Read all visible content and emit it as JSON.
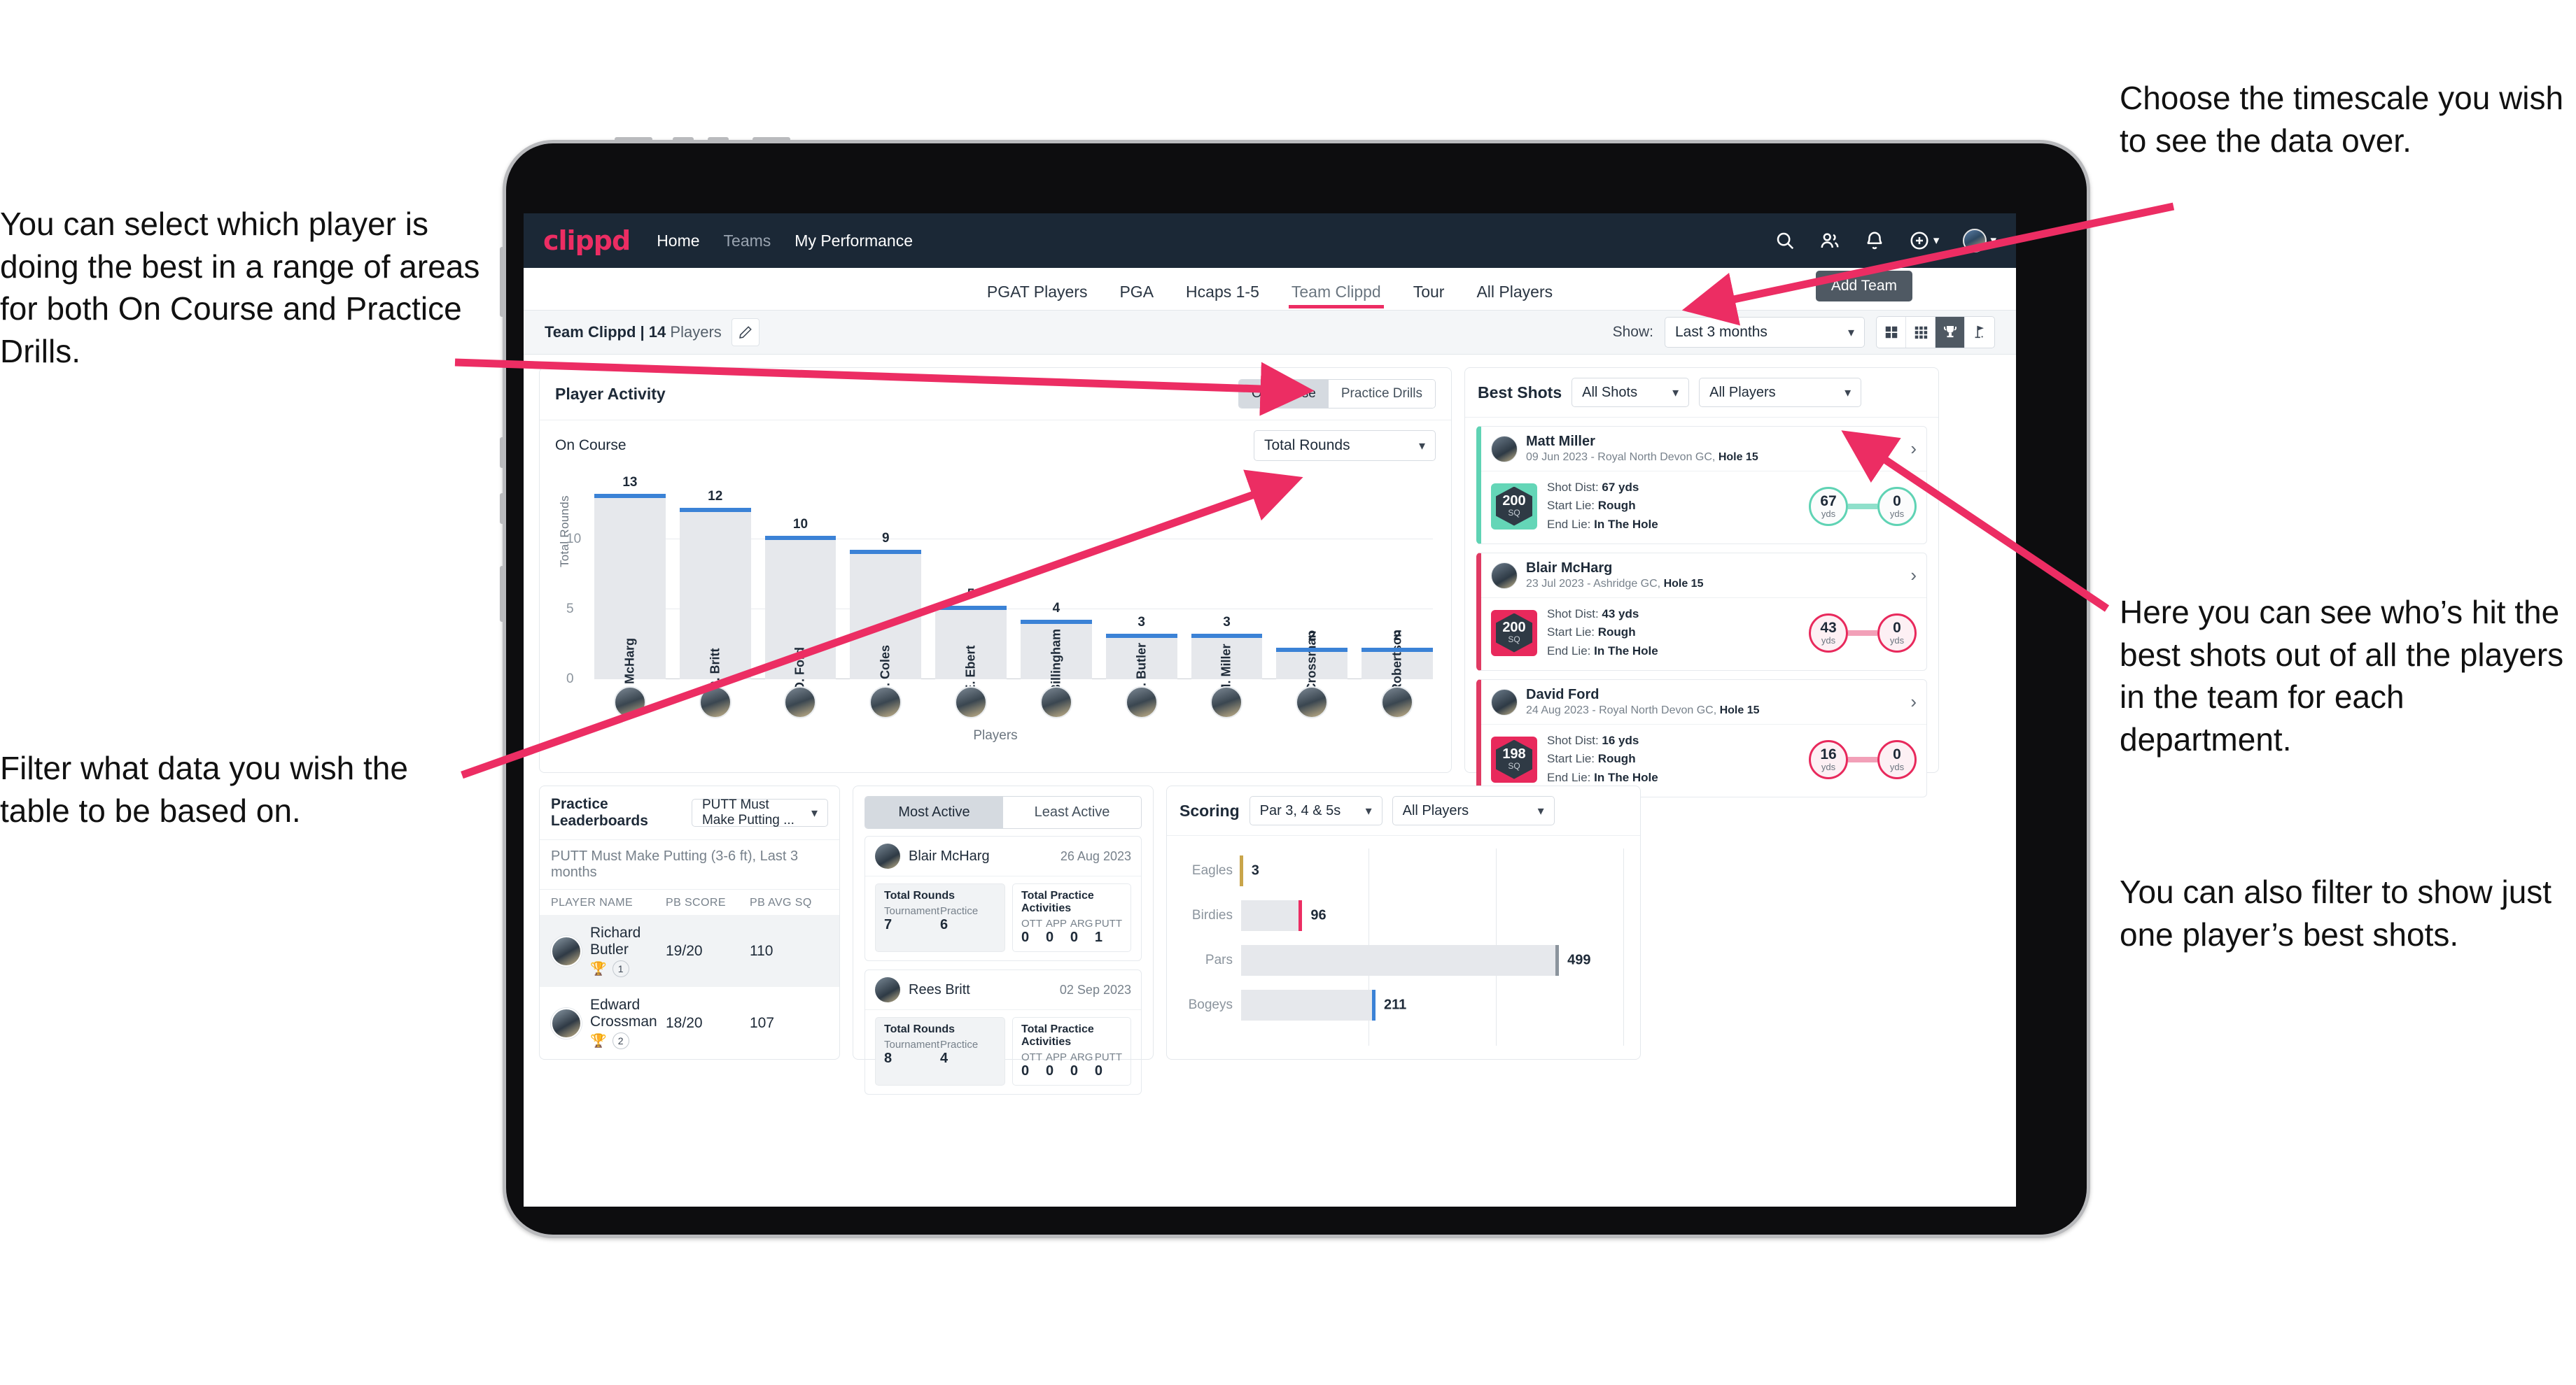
{
  "annotations": {
    "left_top": "You can select which player is doing the best in a range of areas for both On Course and Practice Drills.",
    "left_bottom": "Filter what data you wish the table to be based on.",
    "right_top": "Choose the timescale you wish to see the data over.",
    "right_mid": "Here you can see who’s hit the best shots out of all the players in the team for each department.",
    "right_bottom": "You can also filter to show just one player’s best shots."
  },
  "navbar": {
    "brand": "clippd",
    "links": [
      {
        "label": "Home",
        "dim": false
      },
      {
        "label": "Teams",
        "dim": true
      },
      {
        "label": "My Performance",
        "dim": false
      }
    ],
    "icons": [
      "search-icon",
      "people-icon",
      "bell-icon",
      "plus-circle-icon",
      "avatar"
    ]
  },
  "tabs": [
    {
      "label": "PGAT Players",
      "active": false
    },
    {
      "label": "PGA",
      "active": false
    },
    {
      "label": "Hcaps 1-5",
      "active": false
    },
    {
      "label": "Team Clippd",
      "active": true
    },
    {
      "label": "Tour",
      "active": false
    },
    {
      "label": "All Players",
      "active": false
    }
  ],
  "add_team_button": "Add Team",
  "subbar": {
    "team_name": "Team Clippd",
    "separator": "|",
    "player_count": "14",
    "players_word": "Players",
    "show_label": "Show:",
    "timescale_value": "Last 3 months",
    "view_buttons": [
      "grid-large-icon",
      "grid-small-icon",
      "trophy-icon",
      "flag-icon"
    ],
    "active_view": 2
  },
  "player_activity": {
    "title": "Player Activity",
    "segments": [
      {
        "label": "On Course",
        "active": true
      },
      {
        "label": "Practice Drills",
        "active": false
      }
    ],
    "sub_label": "On Course",
    "metric_value": "Total Rounds"
  },
  "chart_data": {
    "type": "bar",
    "title": "Player Activity",
    "xlabel": "Players",
    "ylabel": "Total Rounds",
    "categories": [
      "B. McHarg",
      "R. Britt",
      "D. Ford",
      "J. Coles",
      "E. Ebert",
      "D. Billingham",
      "R. Butler",
      "M. Miller",
      "E. Crossman",
      "C. Robertson"
    ],
    "values": [
      13,
      12,
      10,
      9,
      5,
      4,
      3,
      3,
      2,
      2
    ],
    "yticks": [
      0,
      5,
      10
    ],
    "ylim": [
      0,
      14
    ],
    "grid": true,
    "bar_color": "#e6e8ec",
    "cap_color": "#3b82d6"
  },
  "best_shots": {
    "title": "Best Shots",
    "shot_filter": "All Shots",
    "player_filter": "All Players",
    "cards": [
      {
        "name": "Matt Miller",
        "meta_date": "09 Jun 2023",
        "meta_sep": " - ",
        "meta_course": "Royal North Devon GC,",
        "meta_hole": "Hole 15",
        "sq_value": "200",
        "sq_unit": "SQ",
        "shot_dist_label": "Shot Dist:",
        "shot_dist_value": "67 yds",
        "start_lie_label": "Start Lie:",
        "start_lie_value": "Rough",
        "end_lie_label": "End Lie:",
        "end_lie_value": "In The Hole",
        "from_value": "67",
        "from_unit": "yds",
        "to_value": "0",
        "to_unit": "yds",
        "accent": "teal"
      },
      {
        "name": "Blair McHarg",
        "meta_date": "23 Jul 2023",
        "meta_sep": " - ",
        "meta_course": "Ashridge GC,",
        "meta_hole": "Hole 15",
        "sq_value": "200",
        "sq_unit": "SQ",
        "shot_dist_label": "Shot Dist:",
        "shot_dist_value": "43 yds",
        "start_lie_label": "Start Lie:",
        "start_lie_value": "Rough",
        "end_lie_label": "End Lie:",
        "end_lie_value": "In The Hole",
        "from_value": "43",
        "from_unit": "yds",
        "to_value": "0",
        "to_unit": "yds",
        "accent": "pink"
      },
      {
        "name": "David Ford",
        "meta_date": "24 Aug 2023",
        "meta_sep": " - ",
        "meta_course": "Royal North Devon GC,",
        "meta_hole": "Hole 15",
        "sq_value": "198",
        "sq_unit": "SQ",
        "shot_dist_label": "Shot Dist:",
        "shot_dist_value": "16 yds",
        "start_lie_label": "Start Lie:",
        "start_lie_value": "Rough",
        "end_lie_label": "End Lie:",
        "end_lie_value": "In The Hole",
        "from_value": "16",
        "from_unit": "yds",
        "to_value": "0",
        "to_unit": "yds",
        "accent": "pink"
      }
    ]
  },
  "practice_leaderboards": {
    "title": "Practice Leaderboards",
    "drill_filter": "PUTT Must Make Putting ...",
    "subtitle_bold": "PUTT Must Make Putting (3-6 ft),",
    "subtitle_light": "Last 3 months",
    "columns": [
      "PLAYER NAME",
      "PB SCORE",
      "PB AVG SQ"
    ],
    "rows": [
      {
        "name": "Richard Butler",
        "rank": "1",
        "trophy": "gold",
        "pb_score": "19/20",
        "pb_avg_sq": "110"
      },
      {
        "name": "Edward Crossman",
        "rank": "2",
        "trophy": "silver",
        "pb_score": "18/20",
        "pb_avg_sq": "107"
      }
    ]
  },
  "activity_panel": {
    "tabs": [
      {
        "label": "Most Active",
        "active": true
      },
      {
        "label": "Least Active",
        "active": false
      }
    ],
    "cards": [
      {
        "name": "Blair McHarg",
        "date": "26 Aug 2023",
        "rounds_title": "Total Rounds",
        "rounds_keys": [
          "Tournament",
          "Practice"
        ],
        "rounds_values": [
          "7",
          "6"
        ],
        "practice_title": "Total Practice Activities",
        "practice_keys": [
          "OTT",
          "APP",
          "ARG",
          "PUTT"
        ],
        "practice_values": [
          "0",
          "0",
          "0",
          "1"
        ]
      },
      {
        "name": "Rees Britt",
        "date": "02 Sep 2023",
        "rounds_title": "Total Rounds",
        "rounds_keys": [
          "Tournament",
          "Practice"
        ],
        "rounds_values": [
          "8",
          "4"
        ],
        "practice_title": "Total Practice Activities",
        "practice_keys": [
          "OTT",
          "APP",
          "ARG",
          "PUTT"
        ],
        "practice_values": [
          "0",
          "0",
          "0",
          "0"
        ]
      }
    ]
  },
  "scoring": {
    "title": "Scoring",
    "par_filter": "Par 3, 4 & 5s",
    "player_filter": "All Players"
  },
  "scoring_chart": {
    "type": "bar",
    "orientation": "horizontal",
    "title": "Scoring",
    "categories": [
      "Eagles",
      "Birdies",
      "Pars",
      "Bogeys"
    ],
    "values": [
      3,
      96,
      499,
      211
    ],
    "labels": [
      "3",
      "96",
      "499",
      "211"
    ],
    "colors": [
      "#c9a54a",
      "#ec2d63",
      "#8b949d",
      "#3b82d6"
    ],
    "xlim": [
      0,
      600
    ],
    "grid": true
  }
}
